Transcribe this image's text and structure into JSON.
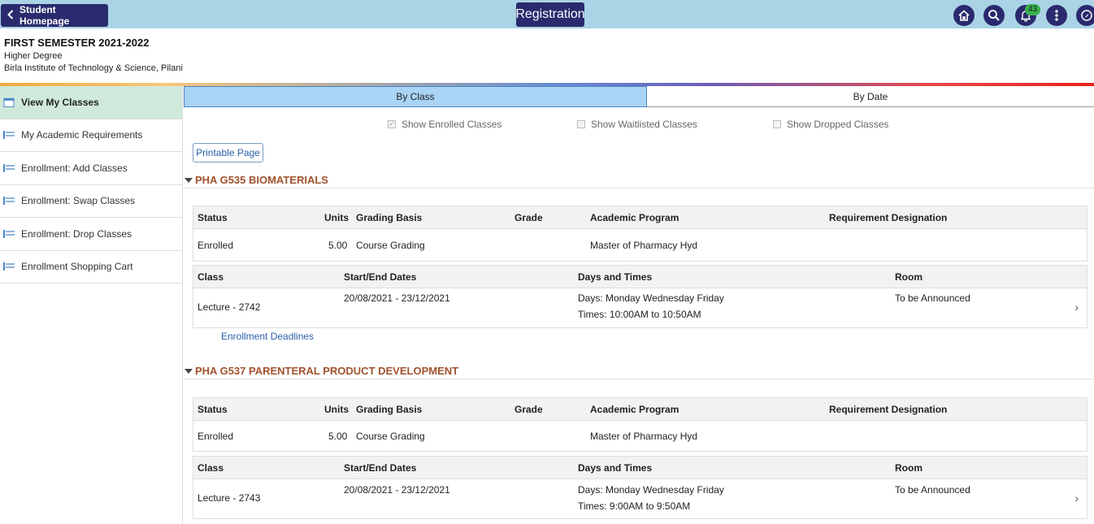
{
  "header": {
    "back_label": "Student Homepage",
    "title": "Registration",
    "notification_count": "43",
    "icons": [
      "home-icon",
      "search-icon",
      "bell-icon",
      "more-vert-icon",
      "navbar-compass-icon"
    ]
  },
  "term": {
    "name": "FIRST SEMESTER 2021-2022",
    "career": "Higher Degree",
    "institution": "Birla Institute of Technology & Science, Pilani"
  },
  "sidebar": {
    "items": [
      {
        "label": "View My Classes"
      },
      {
        "label": "My Academic Requirements"
      },
      {
        "label": "Enrollment:  Add Classes"
      },
      {
        "label": "Enrollment:  Swap Classes"
      },
      {
        "label": "Enrollment:  Drop Classes"
      },
      {
        "label": "Enrollment Shopping Cart"
      }
    ]
  },
  "tabs": {
    "by_class": "By Class",
    "by_date": "By Date"
  },
  "filters": {
    "enrolled": "Show Enrolled Classes",
    "waitlisted": "Show Waitlisted Classes",
    "dropped": "Show Dropped Classes"
  },
  "printable_label": "Printable Page",
  "enroll_headers": {
    "status": "Status",
    "units": "Units",
    "grading": "Grading Basis",
    "grade": "Grade",
    "program": "Academic Program",
    "requirement": "Requirement Designation"
  },
  "class_headers": {
    "class": "Class",
    "dates": "Start/End Dates",
    "days_times": "Days and Times",
    "room": "Room"
  },
  "courses": [
    {
      "title": "PHA G535 BIOMATERIALS",
      "status": "Enrolled",
      "units": "5.00",
      "grading": "Course Grading",
      "grade": "",
      "program": "Master of Pharmacy Hyd",
      "requirement": "",
      "class": "Lecture - 2742",
      "dates": "20/08/2021 - 23/12/2021",
      "days": "Days: Monday Wednesday Friday",
      "times": "Times: 10:00AM to 10:50AM",
      "room": "To be Announced",
      "deadlines": "Enrollment Deadlines"
    },
    {
      "title": "PHA G537 PARENTERAL PRODUCT DEVELOPMENT",
      "status": "Enrolled",
      "units": "5.00",
      "grading": "Course Grading",
      "grade": "",
      "program": "Master of Pharmacy Hyd",
      "requirement": "",
      "class": "Lecture - 2743",
      "dates": "20/08/2021 - 23/12/2021",
      "days": "Days: Monday Wednesday Friday",
      "times": "Times: 9:00AM to 9:50AM",
      "room": "To be Announced"
    }
  ]
}
